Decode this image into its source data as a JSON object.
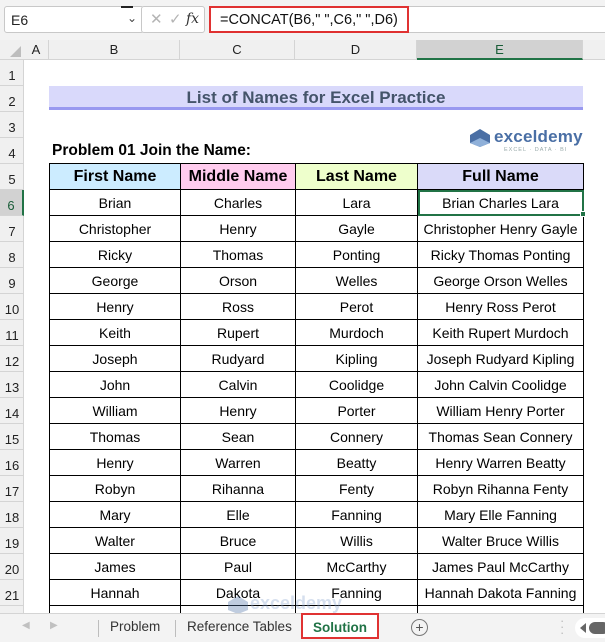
{
  "formula_bar": {
    "name_box": "E6",
    "cancel_icon": "✕",
    "enter_icon": "✓",
    "fx_label": "fx",
    "formula": "=CONCAT(B6,\" \",C6,\" \",D6)"
  },
  "columns": [
    "A",
    "B",
    "C",
    "D",
    "E"
  ],
  "rows": [
    "1",
    "2",
    "3",
    "4",
    "5",
    "6",
    "7",
    "8",
    "9",
    "10",
    "11",
    "12",
    "13",
    "14",
    "15",
    "16",
    "17",
    "18",
    "19",
    "20",
    "21"
  ],
  "selected_cell": "E6",
  "sheet": {
    "title": "List of Names for Excel Practice",
    "problem_label": "Problem 01 Join the Name:",
    "logo": {
      "name": "exceldemy",
      "tagline": "EXCEL · DATA · BI"
    },
    "table": {
      "headers": [
        "First Name",
        "Middle Name",
        "Last Name",
        "Full Name"
      ],
      "rows": [
        [
          "Brian",
          "Charles",
          "Lara",
          "Brian Charles Lara"
        ],
        [
          "Christopher",
          "Henry",
          "Gayle",
          "Christopher Henry Gayle"
        ],
        [
          "Ricky",
          "Thomas",
          "Ponting",
          "Ricky Thomas Ponting"
        ],
        [
          "George",
          "Orson",
          "Welles",
          "George Orson Welles"
        ],
        [
          "Henry",
          "Ross",
          "Perot",
          "Henry Ross Perot"
        ],
        [
          "Keith",
          "Rupert",
          "Murdoch",
          "Keith Rupert Murdoch"
        ],
        [
          "Joseph",
          "Rudyard",
          "Kipling",
          "Joseph Rudyard Kipling"
        ],
        [
          "John",
          "Calvin",
          "Coolidge",
          "John Calvin Coolidge"
        ],
        [
          "William",
          "Henry",
          "Porter",
          "William Henry Porter"
        ],
        [
          "Thomas",
          "Sean",
          "Connery",
          "Thomas Sean Connery"
        ],
        [
          "Henry",
          "Warren",
          "Beatty",
          "Henry Warren Beatty"
        ],
        [
          "Robyn",
          "Rihanna",
          "Fenty",
          "Robyn Rihanna Fenty"
        ],
        [
          "Mary",
          "Elle",
          "Fanning",
          "Mary Elle Fanning"
        ],
        [
          "Walter",
          "Bruce",
          "Willis",
          "Walter Bruce Willis"
        ],
        [
          "James",
          "Paul",
          "McCarthy",
          "James Paul McCarthy"
        ],
        [
          "Hannah",
          "Dakota",
          "Fanning",
          "Hannah Dakota Fanning"
        ]
      ]
    }
  },
  "watermark": {
    "name": "exceldemy",
    "tagline": "EXCEL · DATA · BI"
  },
  "tabs": {
    "items": [
      "Problem",
      "Reference Tables",
      "Solution"
    ],
    "active": "Solution",
    "add_icon": "+"
  },
  "colors": {
    "accent_green": "#217346",
    "highlight_red": "#e03232",
    "title_bg": "#d9d9fb",
    "header_first": "#ccecff",
    "header_middle": "#ffccee",
    "header_last": "#eeffcc",
    "header_full": "#dadaf9"
  }
}
